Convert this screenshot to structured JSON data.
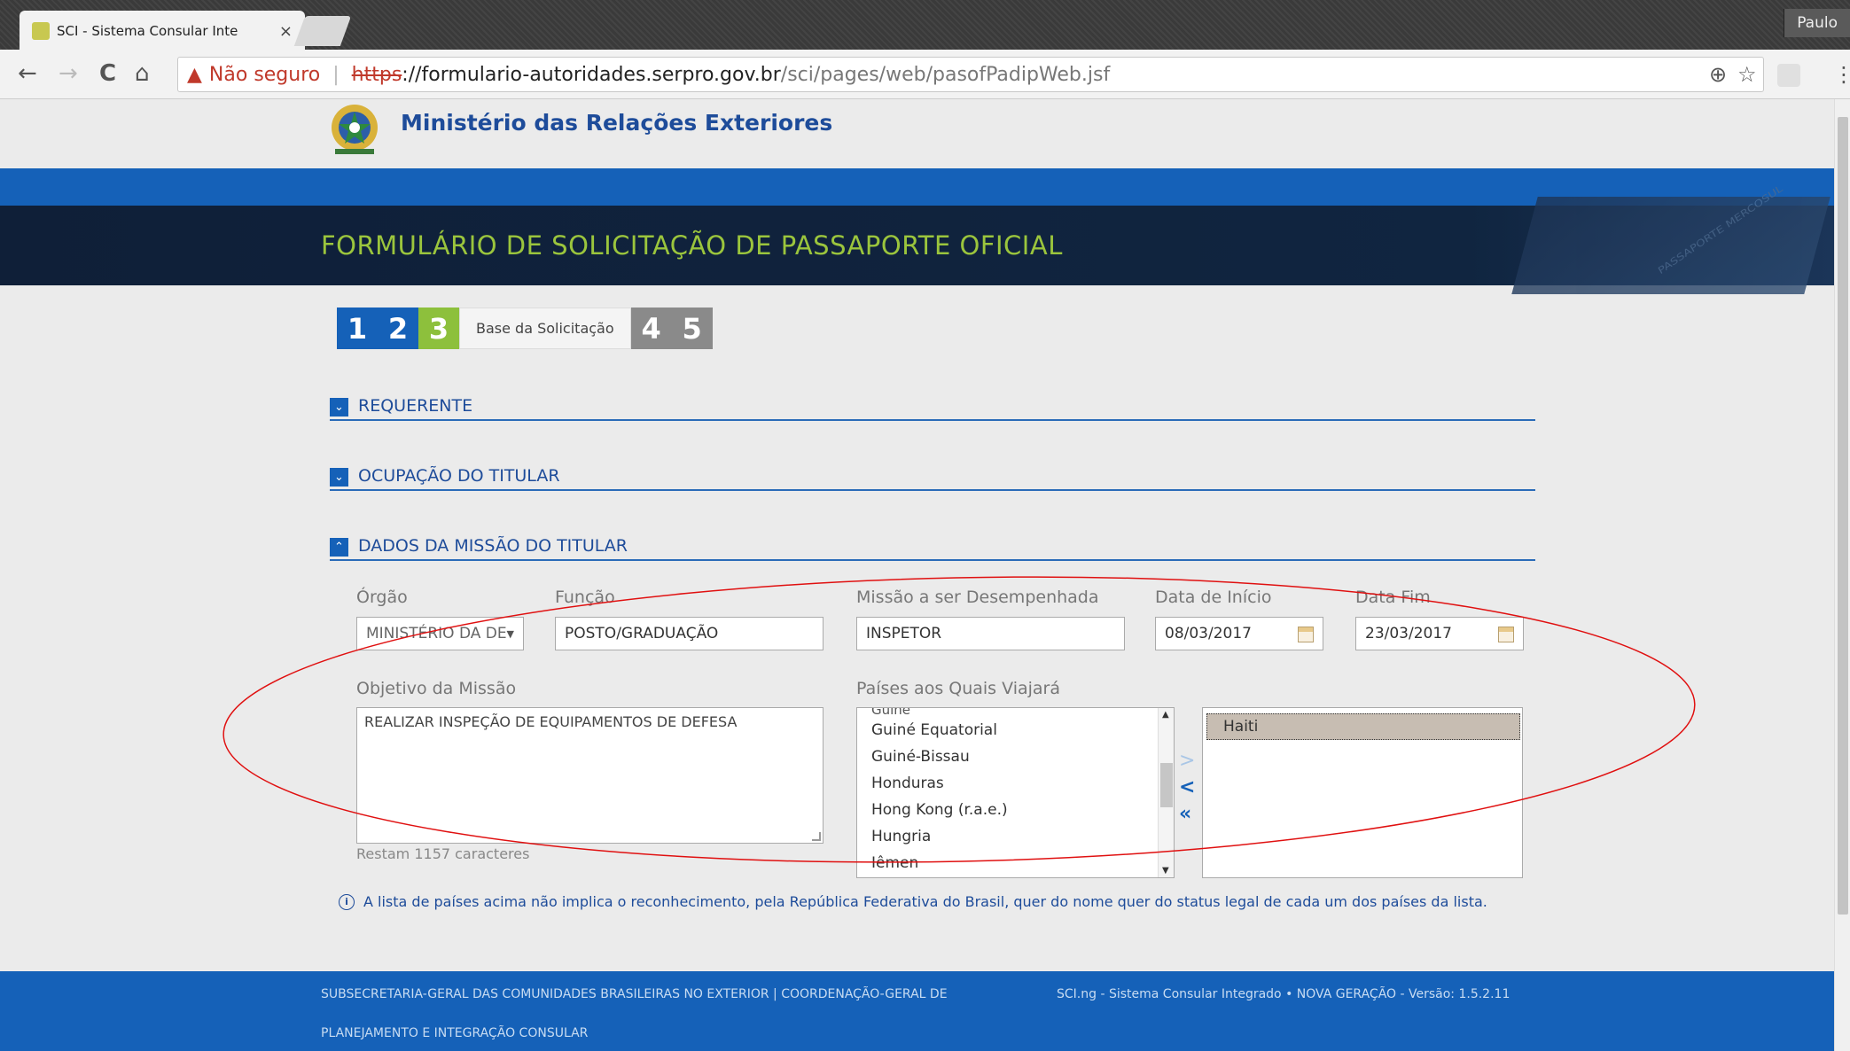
{
  "browser": {
    "tab_title": "SCI - Sistema Consular Inte",
    "tab_close": "×",
    "profile": "Paulo",
    "security_label": "Não seguro",
    "url_scheme": "https",
    "url_host": "://formulario-autoridades.serpro.gov.br",
    "url_path": "/sci/pages/web/pasofPadipWeb.jsf",
    "icons": {
      "back": "←",
      "forward": "→",
      "reload": "C",
      "home": "⌂",
      "warning": "▲",
      "zoom": "⊕",
      "star": "☆",
      "menu": "⋮"
    }
  },
  "header": {
    "ministry": "Ministério das Relações Exteriores",
    "form_title": "FORMULÁRIO DE SOLICITAÇÃO DE PASSAPORTE OFICIAL",
    "passport_text": "PASSAPORTE MERCOSUL"
  },
  "steps": {
    "s1": "1",
    "s2": "2",
    "s3": "3",
    "current_label": "Base da Solicitação",
    "s4": "4",
    "s5": "5"
  },
  "sections": {
    "requerente": "REQUERENTE",
    "ocupacao": "OCUPAÇÃO DO TITULAR",
    "missao": "DADOS DA MISSÃO DO TITULAR"
  },
  "form": {
    "orgao_label": "Órgão",
    "orgao_value": "MINISTÉRIO DA DE",
    "funcao_label": "Função",
    "funcao_value": "POSTO/GRADUAÇÃO",
    "missao_label": "Missão a ser Desempenhada",
    "missao_value": "INSPETOR",
    "inicio_label": "Data de Início",
    "inicio_value": "08/03/2017",
    "fim_label": "Data Fim",
    "fim_value": "23/03/2017",
    "objetivo_label": "Objetivo da Missão",
    "objetivo_value": "REALIZAR INSPEÇÃO DE EQUIPAMENTOS DE DEFESA",
    "remaining": "Restam 1157 caracteres",
    "paises_label": "Países aos Quais Viajará",
    "countries_cut": "Guiné",
    "countries": [
      "Guiné Equatorial",
      "Guiné-Bissau",
      "Honduras",
      "Hong Kong (r.a.e.)",
      "Hungria",
      "Iêmen"
    ],
    "transfer_add": ">",
    "transfer_remove": "<",
    "transfer_remove_all": "«",
    "selected": [
      "Haiti"
    ]
  },
  "info_text": "A lista de países acima não implica o reconhecimento, pela República Federativa do Brasil, quer do nome quer do status legal de cada um dos países da lista.",
  "footer": {
    "left_line1": "SUBSECRETARIA-GERAL DAS COMUNIDADES BRASILEIRAS NO EXTERIOR | COORDENAÇÃO-GERAL DE",
    "left_line2": "PLANEJAMENTO E INTEGRAÇÃO CONSULAR",
    "right": "SCI.ng - Sistema Consular Integrado • NOVA GERAÇÃO - Versão: 1.5.2.11"
  },
  "colors": {
    "brand_blue": "#1561b8",
    "step_green": "#8dc03c",
    "title_green": "#9bc53d",
    "annotation_red": "#e01010"
  }
}
